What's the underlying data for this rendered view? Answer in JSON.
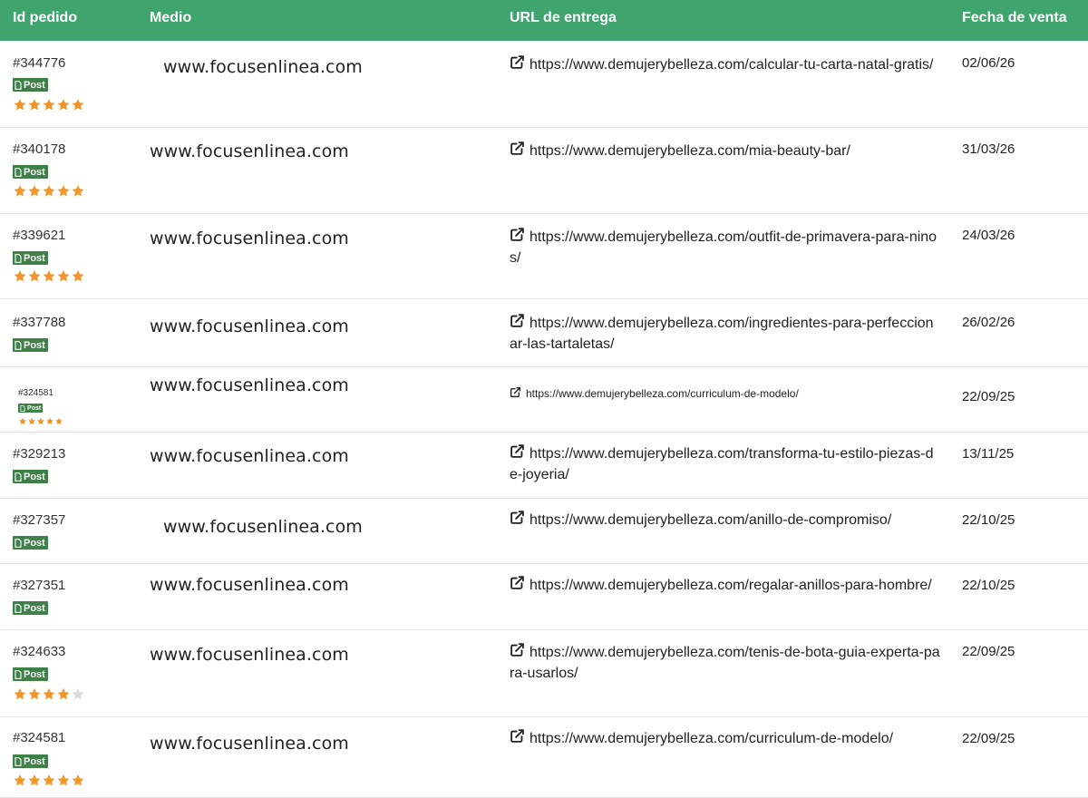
{
  "columns": {
    "order_id": "Id pedido",
    "medium": "Medio",
    "url": "URL de entrega",
    "date": "Fecha de venta"
  },
  "colors": {
    "header_bg": "#3fa46e",
    "badge_bg": "#3f7f48",
    "star_filled": "#f0962a",
    "star_empty": "#dcdcdc"
  },
  "rows": [
    {
      "id": "#344776",
      "badge": "Post",
      "rating": 5,
      "medium": "www.focusenlinea.com",
      "url": "https://www.demujerybelleza.com/calcular-tu-carta-natal-gratis/",
      "date": "02/06/26"
    },
    {
      "id": "#340178",
      "badge": "Post",
      "rating": 5,
      "medium": "www.focusenlinea.com",
      "url": "https://www.demujerybelleza.com/mia-beauty-bar/",
      "date": "31/03/26"
    },
    {
      "id": "#339621",
      "badge": "Post",
      "rating": 5,
      "medium": "www.focusenlinea.com",
      "url": "https://www.demujerybelleza.com/outfit-de-primavera-para-ninos/",
      "date": "24/03/26"
    },
    {
      "id": "#337788",
      "badge": "Post",
      "rating": 0,
      "medium": "www.focusenlinea.com",
      "url": "https://www.demujerybelleza.com/ingredientes-para-perfeccionar-las-tartaletas/",
      "date": "26/02/26"
    },
    {
      "id": "#324581",
      "badge": "Post",
      "rating": 5,
      "medium": "www.focusenlinea.com",
      "url": "https://www.demujerybelleza.com/curriculum-de-modelo/",
      "date": "22/09/25"
    },
    {
      "id": "#329213",
      "badge": "Post",
      "rating": 0,
      "medium": "www.focusenlinea.com",
      "url": "https://www.demujerybelleza.com/transforma-tu-estilo-piezas-de-joyeria/",
      "date": "13/11/25"
    },
    {
      "id": "#327357",
      "badge": "Post",
      "rating": 0,
      "medium": "www.focusenlinea.com",
      "url": "https://www.demujerybelleza.com/anillo-de-compromiso/",
      "date": "22/10/25"
    },
    {
      "id": "#327351",
      "badge": "Post",
      "rating": 0,
      "medium": "www.focusenlinea.com",
      "url": "https://www.demujerybelleza.com/regalar-anillos-para-hombre/",
      "date": "22/10/25"
    },
    {
      "id": "#324633",
      "badge": "Post",
      "rating": 4,
      "medium": "www.focusenlinea.com",
      "url": "https://www.demujerybelleza.com/tenis-de-bota-guia-experta-para-usarlos/",
      "date": "22/09/25"
    },
    {
      "id": "#324581",
      "badge": "Post",
      "rating": 5,
      "medium": "www.focusenlinea.com",
      "url": "https://www.demujerybelleza.com/curriculum-de-modelo/",
      "date": "22/09/25"
    }
  ]
}
